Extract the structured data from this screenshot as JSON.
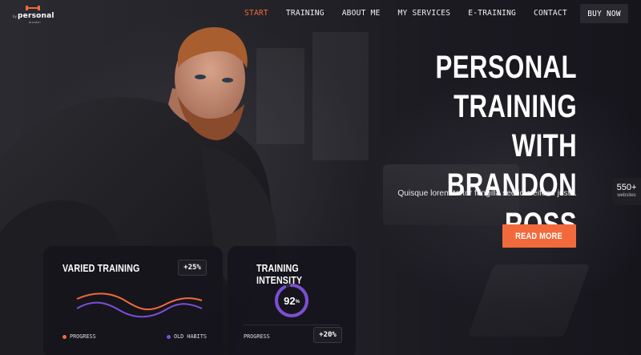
{
  "nav": {
    "logo": {
      "small_text": "by",
      "word": "personal",
      "sub_text": "brandon"
    },
    "items": [
      {
        "label": "START",
        "active": true
      },
      {
        "label": "TRAINING",
        "active": false
      },
      {
        "label": "ABOUT ME",
        "active": false
      },
      {
        "label": "MY SERVICES",
        "active": false
      },
      {
        "label": "E-TRAINING",
        "active": false
      },
      {
        "label": "CONTACT",
        "active": false
      }
    ],
    "buy_label": "BUY NOW"
  },
  "hero": {
    "headline_lines": [
      "PERSONAL",
      "TRAINING WITH",
      "BRANDON ROSS"
    ],
    "tagline": "Quisque lorem tortor fringilla sed id eleifend justo.",
    "cta_label": "READ MORE"
  },
  "badge": {
    "count": "550+",
    "label": "websites"
  },
  "cards": {
    "varied": {
      "title": "VARIED TRAINING",
      "change": "+25%",
      "legend": [
        {
          "label": "PROGRESS",
          "color": "#f26a3b"
        },
        {
          "label": "OLD HABITS",
          "color": "#7a4fd6"
        }
      ]
    },
    "intensity": {
      "title": "TRAINING INTENSITY",
      "value": "92",
      "unit": "%",
      "percent": 92,
      "progress_label": "PROGRESS",
      "change": "+20%"
    }
  },
  "colors": {
    "accent": "#f26a3b",
    "purple": "#7a4fd6",
    "background": "#16151c"
  }
}
